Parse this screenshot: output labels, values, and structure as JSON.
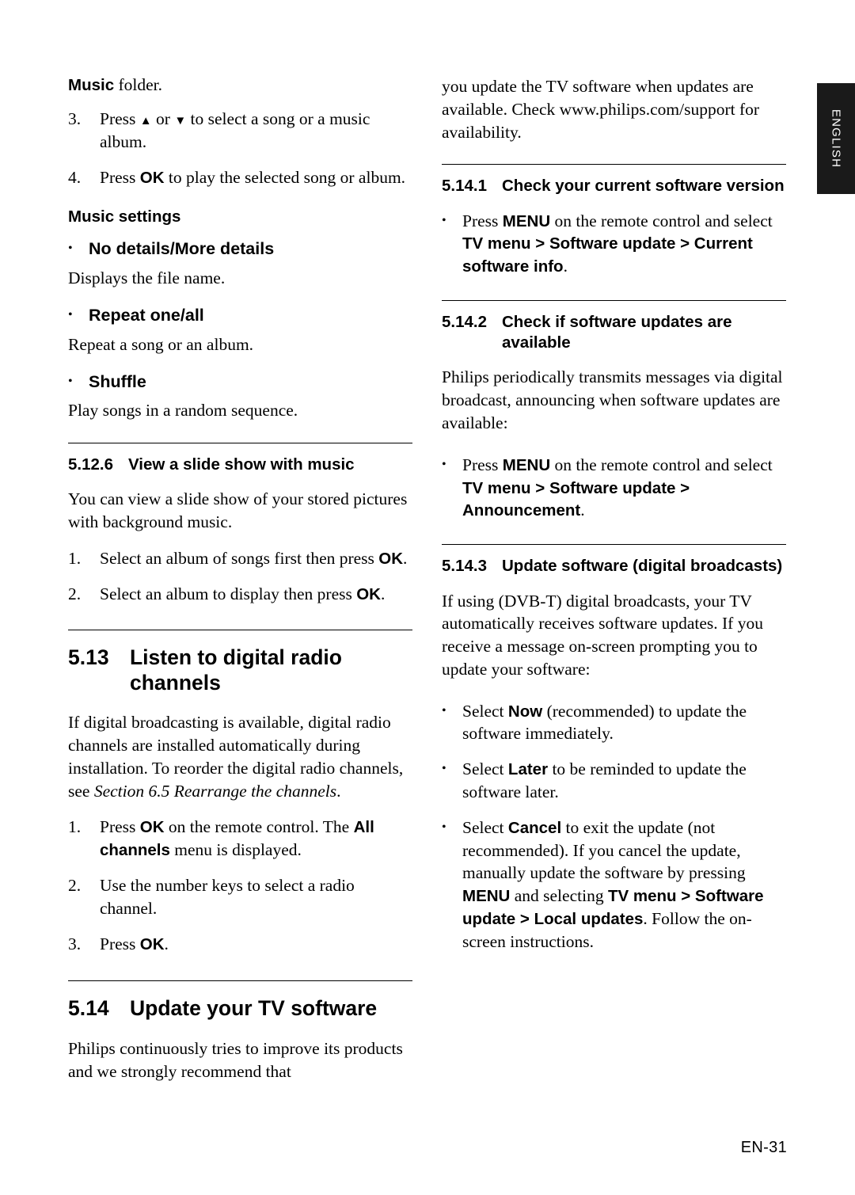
{
  "page": {
    "language_tab": "ENGLISH",
    "page_number": "EN-31"
  },
  "left_column": {
    "music_folder_line": {
      "bold": "Music",
      "rest": " folder."
    },
    "steps_music": [
      {
        "marker": "3.",
        "text_parts": [
          "Press ",
          "▲",
          " or ",
          "▼",
          " to select a song or a music album."
        ]
      },
      {
        "marker": "4.",
        "text_pre": "Press ",
        "bold": "OK",
        "text_post": " to play the selected song or album."
      }
    ],
    "music_settings_heading": "Music settings",
    "settings": [
      {
        "title": "No details/More details",
        "desc": "Displays the file name."
      },
      {
        "title": "Repeat one/all",
        "desc": "Repeat a song or an album."
      },
      {
        "title": "Shuffle",
        "desc": "Play songs in a random sequence."
      }
    ],
    "section_5_12_6": {
      "number": "5.12.6",
      "title": "View a slide show with music",
      "intro": "You can view a slide show of your stored pictures with background music.",
      "steps": [
        {
          "marker": "1.",
          "pre": "Select an album of songs first then press ",
          "bold": "OK",
          "post": "."
        },
        {
          "marker": "2.",
          "pre": "Select an album to display then press ",
          "bold": "OK",
          "post": "."
        }
      ]
    },
    "section_5_13": {
      "number": "5.13",
      "title": "Listen to digital radio channels",
      "intro_pre": "If digital broadcasting is available, digital radio channels are installed automatically during installation. To reorder the digital radio channels, see ",
      "intro_italic": "Section 6.5 Rearrange the channels",
      "intro_post": ".",
      "steps": [
        {
          "marker": "1.",
          "pre": "Press ",
          "bold1": "OK",
          "mid": " on the remote control. The ",
          "bold2": "All channels",
          "post": " menu is displayed."
        },
        {
          "marker": "2.",
          "pre": "Use the number keys to select a radio channel.",
          "bold1": "",
          "mid": "",
          "bold2": "",
          "post": ""
        },
        {
          "marker": "3.",
          "pre": "Press ",
          "bold1": "OK",
          "mid": ".",
          "bold2": "",
          "post": ""
        }
      ]
    },
    "section_5_14": {
      "number": "5.14",
      "title": "Update your TV software",
      "intro": "Philips continuously tries to improve its products and we strongly recommend that"
    }
  },
  "right_column": {
    "continued_intro": "you update the TV software when updates are available. Check www.philips.com/support for availability.",
    "section_5_14_1": {
      "number": "5.14.1",
      "title": "Check your current software version",
      "bullet": {
        "pre": "Press ",
        "bold1": "MENU",
        "mid1": " on the remote control and select ",
        "bold2": "TV menu",
        "sep1": " > ",
        "bold3": "Software update",
        "sep2": " > ",
        "bold4": "Current software info",
        "post": "."
      }
    },
    "section_5_14_2": {
      "number": "5.14.2",
      "title": "Check if software updates are available",
      "intro": "Philips periodically transmits messages via digital broadcast, announcing when software updates are available:",
      "bullet": {
        "pre": "Press ",
        "bold1": "MENU",
        "mid1": " on the remote control and select ",
        "bold2": "TV menu",
        "sep1": " > ",
        "bold3": "Software update",
        "sep2": " > ",
        "bold4": "Announcement",
        "post": "."
      }
    },
    "section_5_14_3": {
      "number": "5.14.3",
      "title": "Update software (digital broadcasts)",
      "intro": "If using (DVB-T) digital broadcasts, your TV automatically receives software updates. If you receive a message on-screen prompting you to update your software:",
      "bullets": [
        {
          "pre": "Select ",
          "bold": "Now",
          "post": " (recommended) to update the software immediately."
        },
        {
          "pre": "Select ",
          "bold": "Later",
          "post": " to be reminded to update the software later."
        },
        {
          "pre": "Select ",
          "bold": "Cancel",
          "post": " to exit the update (not recommended). If you cancel the update, manually update the software by pressing "
        }
      ],
      "cancel_cont": {
        "bold1": "MENU",
        "mid1": " and selecting ",
        "bold2": "TV menu",
        "sep1": " > ",
        "bold3": "Software update",
        "sep2": " > ",
        "bold4": "Local updates",
        "post": ".",
        "final": "Follow the on-screen instructions."
      }
    }
  }
}
